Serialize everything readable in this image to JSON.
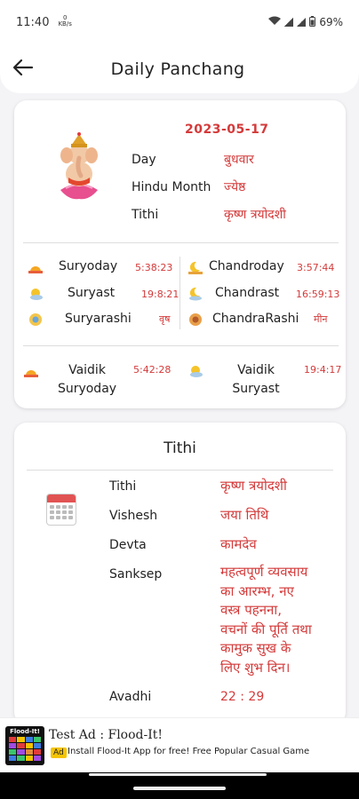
{
  "status_bar": {
    "time": "11:40",
    "data_rate_top": "0",
    "data_rate_unit": "KB/s",
    "battery": "69%"
  },
  "header": {
    "title": "Daily Panchang",
    "back_icon": "arrow-left-icon"
  },
  "summary": {
    "date": "2023-05-17",
    "rows": [
      {
        "label": "Day",
        "value": "बुधवार"
      },
      {
        "label": "Hindu Month",
        "value": "ज्येष्ठ"
      },
      {
        "label": "Tithi",
        "value": "कृष्ण त्रयोदशी"
      }
    ],
    "sun_moon": [
      {
        "label": "Suryoday",
        "value": "5:38:23",
        "icon": "sunrise-icon"
      },
      {
        "label": "Suryast",
        "value": "19:8:21",
        "icon": "sunset-icon"
      },
      {
        "label": "Suryarashi",
        "value": "वृष",
        "icon": "sun-sign-icon"
      },
      {
        "label": "Chandroday",
        "value": "3:57:44",
        "icon": "moonrise-icon"
      },
      {
        "label": "Chandrast",
        "value": "16:59:13",
        "icon": "moonset-icon"
      },
      {
        "label": "ChandraRashi",
        "value": "मीन",
        "icon": "moon-sign-icon"
      }
    ],
    "vaidik": [
      {
        "label_line1": "Vaidik",
        "label_line2": "Suryoday",
        "value": "5:42:28",
        "icon": "sunrise-icon"
      },
      {
        "label_line1": "Vaidik",
        "label_line2": "Suryast",
        "value": "19:4:17",
        "icon": "sunset-icon"
      }
    ]
  },
  "tithi_section": {
    "title": "Tithi",
    "rows": [
      {
        "label": "Tithi",
        "value": "कृष्ण त्रयोदशी"
      },
      {
        "label": "Vishesh",
        "value": "जया तिथि"
      },
      {
        "label": "Devta",
        "value": "कामदेव"
      },
      {
        "label": "Sanksep",
        "value_lines": [
          "महत्वपूर्ण व्यवसाय",
          "का आरम्भ, नए",
          "वस्त्र पहनना,",
          "वचनों की पूर्ति तथा",
          "कामुक सुख के",
          "लिए शुभ दिन।"
        ]
      },
      {
        "label": "Avadhi",
        "value": "22 : 29"
      }
    ]
  },
  "ad": {
    "logo_text": "Flood-It!",
    "title": "Test Ad : Flood-It!",
    "badge": "Ad",
    "text": "Install Flood-It App for free! Free Popular Casual Game"
  },
  "colors": {
    "accent": "#d43a3a",
    "background": "#f4f3f6"
  }
}
